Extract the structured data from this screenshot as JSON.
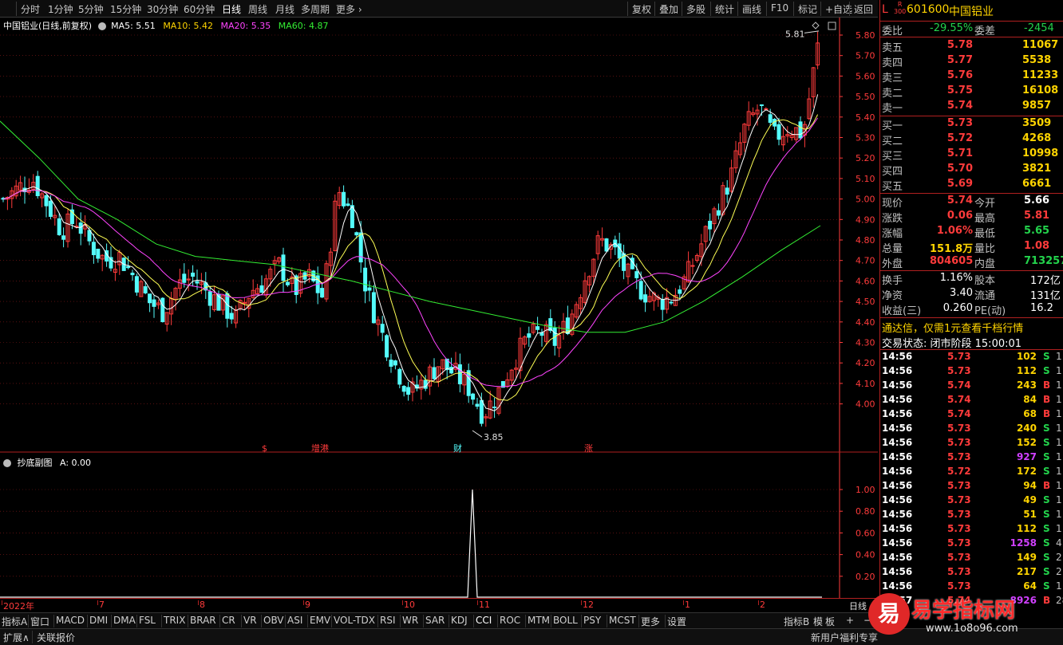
{
  "toolbar": {
    "periods": [
      "分时",
      "1分钟",
      "5分钟",
      "15分钟",
      "30分钟",
      "60分钟",
      "日线",
      "周线",
      "月线",
      "多周期",
      "更多"
    ],
    "active_period": "日线",
    "buttons": [
      "复权",
      "叠加",
      "多股",
      "统计",
      "画线",
      "F10",
      "标记",
      "+自选",
      "返回"
    ]
  },
  "main_header": {
    "title": "中国铝业(日线,前复权)",
    "ma5": "MA5: 5.51",
    "ma10": "MA10: 5.42",
    "ma20": "MA20: 5.35",
    "ma60": "MA60: 4.87"
  },
  "colors": {
    "up": "#ff3b3b",
    "down": "#54fcfc",
    "ma5": "#ffffff",
    "ma10": "#ffff55",
    "ma20": "#ff44ff",
    "ma60": "#33ee33",
    "grid": "#8b1a1a",
    "axis": "#ff3b3b"
  },
  "price_axis": [
    "5.80",
    "5.70",
    "5.60",
    "5.50",
    "5.40",
    "5.30",
    "5.20",
    "5.10",
    "5.00",
    "4.90",
    "4.80",
    "4.70",
    "4.60",
    "4.50",
    "4.40",
    "4.30",
    "4.20",
    "4.10",
    "4.00"
  ],
  "price_annotations": {
    "high": "5.81",
    "low": "3.85"
  },
  "event_markers": [
    {
      "label": "$",
      "color": "#ff3b3b"
    },
    {
      "label": "增港",
      "color": "#ff3b3b"
    },
    {
      "label": "财",
      "color": "#54fcfc"
    },
    {
      "label": "涨",
      "color": "#ff3b3b"
    }
  ],
  "sub_header": {
    "title": "抄底副图",
    "value": "A: 0.00"
  },
  "sub_axis": [
    "1.00",
    "0.80",
    "0.60",
    "0.40",
    "0.20"
  ],
  "date_axis": [
    "2022年",
    "7",
    "8",
    "9",
    "10",
    "11",
    "12",
    "1",
    "2"
  ],
  "date_axis_right": "日线",
  "indicator_tabs": [
    "指标A",
    "窗口",
    "MACD",
    "DMI",
    "DMA",
    "FSL",
    "TRIX",
    "BRAR",
    "CR",
    "VR",
    "OBV",
    "ASI",
    "EMV",
    "VOL-TDX",
    "RSI",
    "WR",
    "SAR",
    "KDJ",
    "CCI",
    "ROC",
    "MTM",
    "BOLL",
    "PSY",
    "MCST",
    "更多",
    "设置"
  ],
  "indicator_right": [
    "指标B",
    "模",
    "板",
    "+",
    "−",
    "↑",
    "↓",
    "←",
    "→"
  ],
  "statusbar": {
    "left": [
      "扩展∧",
      "关联报价"
    ],
    "right": "新用户福利专享"
  },
  "quote": {
    "prefix": "L",
    "badge_top": "R",
    "badge_bottom": "300",
    "code": "601600",
    "name": "中国铝业",
    "weibi_label": "委比",
    "weibi": "-29.55%",
    "weicha_label": "委差",
    "weicha": "-2454",
    "sells": [
      {
        "label": "卖五",
        "price": "5.78",
        "vol": "11067"
      },
      {
        "label": "卖四",
        "price": "5.77",
        "vol": "5538"
      },
      {
        "label": "卖三",
        "price": "5.76",
        "vol": "11233"
      },
      {
        "label": "卖二",
        "price": "5.75",
        "vol": "16108"
      },
      {
        "label": "卖一",
        "price": "5.74",
        "vol": "9857"
      }
    ],
    "buys": [
      {
        "label": "买一",
        "price": "5.73",
        "vol": "3509"
      },
      {
        "label": "买二",
        "price": "5.72",
        "vol": "4268"
      },
      {
        "label": "买三",
        "price": "5.71",
        "vol": "10998"
      },
      {
        "label": "买四",
        "price": "5.70",
        "vol": "3821"
      },
      {
        "label": "买五",
        "price": "5.69",
        "vol": "6661"
      }
    ],
    "stats": [
      {
        "l1": "现价",
        "v1": "5.74",
        "c1": "red",
        "l2": "今开",
        "v2": "5.66",
        "c2": "white"
      },
      {
        "l1": "涨跌",
        "v1": "0.06",
        "c1": "red",
        "l2": "最高",
        "v2": "5.81",
        "c2": "red"
      },
      {
        "l1": "涨幅",
        "v1": "1.06%",
        "c1": "red",
        "l2": "最低",
        "v2": "5.65",
        "c2": "green"
      },
      {
        "l1": "总量",
        "v1": "151.8万",
        "c1": "yellow",
        "l2": "量比",
        "v2": "1.08",
        "c2": "red"
      },
      {
        "l1": "外盘",
        "v1": "804605",
        "c1": "red",
        "l2": "内盘",
        "v2": "713257",
        "c2": "green"
      }
    ],
    "stats2": [
      {
        "l1": "换手",
        "v1": "1.16%",
        "l2": "股本",
        "v2": "172亿"
      },
      {
        "l1": "净资",
        "v1": "3.40",
        "l2": "流通",
        "v2": "131亿"
      },
      {
        "l1": "收益(三)",
        "v1": "0.260",
        "l2": "PE(动)",
        "v2": "16.2"
      }
    ],
    "banner": "通达信，仅需1元查看千档行情",
    "trade_status": "交易状态: 闭市阶段 15:00:01"
  },
  "ticks": [
    {
      "t": "14:56",
      "p": "5.73",
      "v": "102",
      "d": "S",
      "n": "1"
    },
    {
      "t": "14:56",
      "p": "5.73",
      "v": "112",
      "d": "S",
      "n": "1"
    },
    {
      "t": "14:56",
      "p": "5.74",
      "v": "243",
      "d": "B",
      "n": "1"
    },
    {
      "t": "14:56",
      "p": "5.74",
      "v": "84",
      "d": "B",
      "n": "1"
    },
    {
      "t": "14:56",
      "p": "5.74",
      "v": "68",
      "d": "B",
      "n": "1"
    },
    {
      "t": "14:56",
      "p": "5.73",
      "v": "240",
      "d": "S",
      "n": "1"
    },
    {
      "t": "14:56",
      "p": "5.73",
      "v": "152",
      "d": "S",
      "n": "1"
    },
    {
      "t": "14:56",
      "p": "5.73",
      "v": "927",
      "d": "S",
      "n": "1"
    },
    {
      "t": "14:56",
      "p": "5.72",
      "v": "172",
      "d": "S",
      "n": "1"
    },
    {
      "t": "14:56",
      "p": "5.73",
      "v": "94",
      "d": "B",
      "n": "1"
    },
    {
      "t": "14:56",
      "p": "5.73",
      "v": "49",
      "d": "S",
      "n": "1"
    },
    {
      "t": "14:56",
      "p": "5.73",
      "v": "51",
      "d": "S",
      "n": "1"
    },
    {
      "t": "14:56",
      "p": "5.73",
      "v": "112",
      "d": "S",
      "n": "1"
    },
    {
      "t": "14:56",
      "p": "5.73",
      "v": "1258",
      "d": "S",
      "n": "4"
    },
    {
      "t": "14:56",
      "p": "5.73",
      "v": "149",
      "d": "S",
      "n": "2"
    },
    {
      "t": "14:56",
      "p": "5.73",
      "v": "217",
      "d": "S",
      "n": "2"
    },
    {
      "t": "14:56",
      "p": "5.73",
      "v": "64",
      "d": "S",
      "n": "1"
    },
    {
      "t": "14:57",
      "p": "5.74",
      "v": "8926",
      "d": "B",
      "n": "287"
    }
  ],
  "watermark": {
    "text": "易学指标网",
    "url": "www.1o8o96.com",
    "logo": "易"
  },
  "chart_data": {
    "type": "candlestick",
    "x": [
      "2022年",
      "7",
      "8",
      "9",
      "10",
      "11",
      "12",
      "1",
      "2"
    ],
    "ylim": [
      3.85,
      5.81
    ],
    "price_high": 5.81,
    "price_low": 3.85,
    "ma_values": {
      "MA5": 5.51,
      "MA10": 5.42,
      "MA20": 5.35,
      "MA60": 4.87
    },
    "close_path": [
      5.0,
      5.05,
      5.1,
      4.98,
      4.85,
      4.9,
      4.78,
      4.7,
      4.72,
      4.62,
      4.5,
      4.45,
      4.58,
      4.62,
      4.55,
      4.48,
      4.42,
      4.55,
      4.6,
      4.68,
      4.55,
      4.62,
      4.52,
      5.05,
      4.92,
      4.55,
      4.35,
      4.18,
      4.05,
      4.12,
      4.2,
      4.15,
      4.08,
      3.95,
      4.05,
      4.2,
      4.32,
      4.35,
      4.3,
      4.42,
      4.62,
      4.8,
      4.75,
      4.62,
      4.55,
      4.5,
      4.52,
      4.62,
      4.78,
      4.95,
      5.1,
      5.35,
      5.45,
      5.3,
      5.35,
      5.32,
      5.74
    ],
    "ma60_path": [
      5.38,
      5.2,
      5.0,
      4.9,
      4.78,
      4.72,
      4.7,
      4.68,
      4.64,
      4.6,
      4.55,
      4.5,
      4.46,
      4.42,
      4.38,
      4.35,
      4.35,
      4.4,
      4.5,
      4.62,
      4.75,
      4.87
    ],
    "subchart": {
      "title": "抄底副图",
      "series": "A",
      "last": 0.0,
      "ylim": [
        0,
        1.0
      ],
      "spike_value": 1.0,
      "spike_near": "11"
    }
  }
}
